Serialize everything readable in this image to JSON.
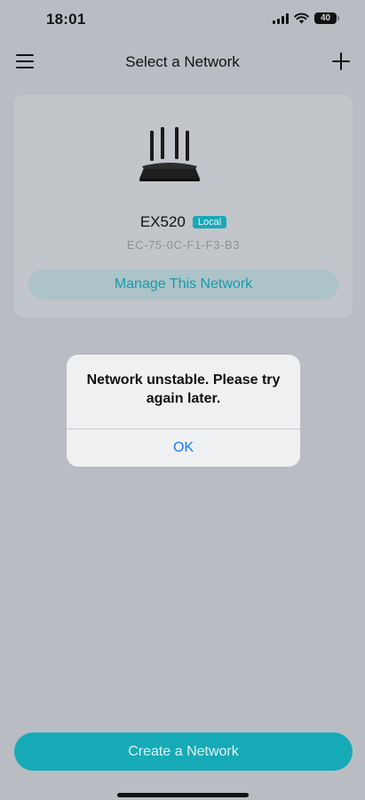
{
  "status_bar": {
    "time": "18:01",
    "battery": "40",
    "icons": [
      "signal-icon",
      "wifi-icon",
      "battery-icon"
    ]
  },
  "nav": {
    "title": "Select a Network",
    "left_icon": "menu-icon",
    "right_icon": "add-icon"
  },
  "network_card": {
    "device_name": "EX520",
    "badge": "Local",
    "mac": "EC-75-0C-F1-F3-B3",
    "manage_label": "Manage This Network",
    "image": "router-image"
  },
  "alert": {
    "message": "Network unstable. Please try again later.",
    "ok_label": "OK"
  },
  "footer": {
    "create_label": "Create a Network"
  },
  "colors": {
    "accent": "#16aab7",
    "dialog_button": "#1a78f2",
    "dimmed_background": "#b9bdc3"
  }
}
